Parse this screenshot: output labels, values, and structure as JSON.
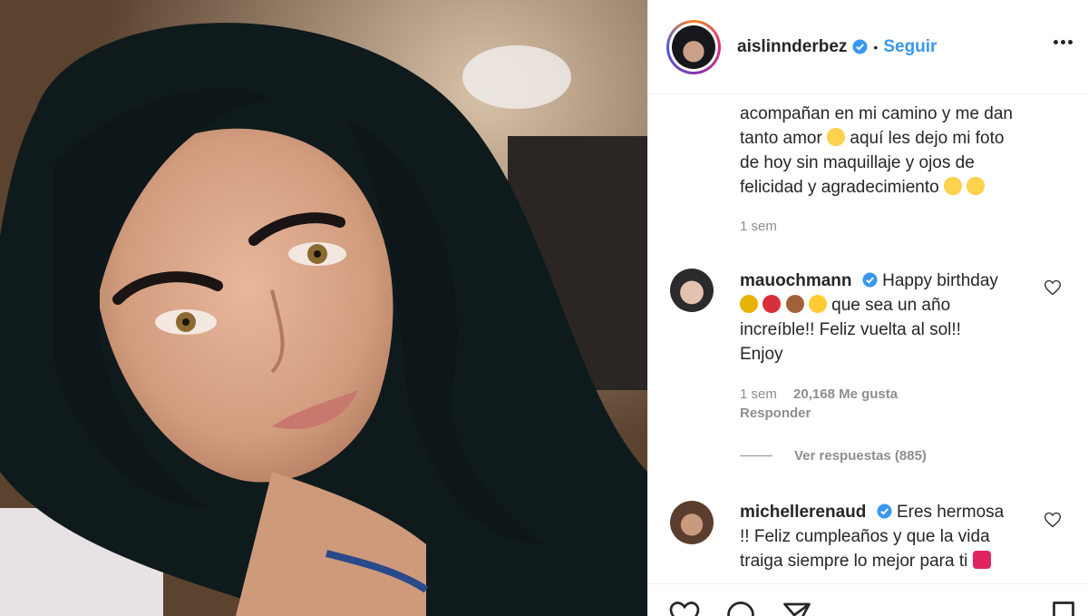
{
  "header": {
    "username": "aislinnderbez",
    "separator": "•",
    "follow_label": "Seguir"
  },
  "caption": {
    "lines": [
      "acompañan en mi camino y me dan",
      "tanto amor",
      "aquí les dejo mi foto",
      "de hoy sin maquillaje y ojos de",
      "felicidad y agradecimiento"
    ],
    "time": "1 sem"
  },
  "comments": [
    {
      "username": "mauochmann",
      "text_1": "Happy birthday",
      "text_2": "que sea un año",
      "text_3": "increíble!! Feliz vuelta al sol!!",
      "text_4": "Enjoy",
      "time": "1 sem",
      "likes": "20,168 Me gusta",
      "reply_label": "Responder",
      "view_replies": "Ver respuestas (885)"
    },
    {
      "username": "michellerenaud",
      "text_1": "Eres hermosa",
      "text_2": "!! Feliz cumpleaños y que la vida",
      "text_3": "traiga siempre lo mejor para ti"
    }
  ],
  "colors": {
    "link": "#3897f0",
    "secondary_text": "#8e8e8e",
    "border": "#efefef"
  },
  "icons": [
    "verified-badge-icon",
    "more-options-icon",
    "heart-icon",
    "comment-icon",
    "share-icon",
    "bookmark-icon"
  ]
}
